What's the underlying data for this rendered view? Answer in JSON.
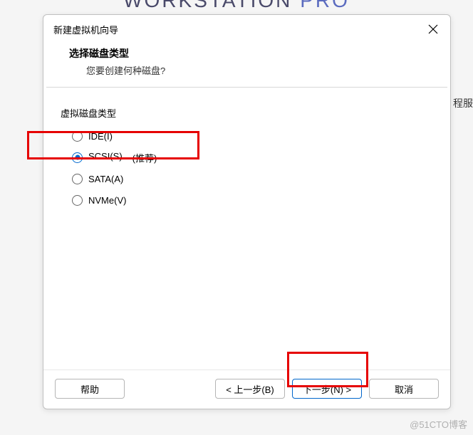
{
  "background": {
    "title_left": "WORKSTATION",
    "title_right": "PRO",
    "right_text": "程服"
  },
  "dialog": {
    "title": "新建虚拟机向导",
    "heading": "选择磁盘类型",
    "subheading": "您要创建何种磁盘?",
    "fieldset_label": "虚拟磁盘类型",
    "options": [
      {
        "label": "IDE(I)",
        "recommend": "",
        "checked": false
      },
      {
        "label": "SCSI(S)",
        "recommend": "(推荐)",
        "checked": true
      },
      {
        "label": "SATA(A)",
        "recommend": "",
        "checked": false
      },
      {
        "label": "NVMe(V)",
        "recommend": "",
        "checked": false
      }
    ],
    "buttons": {
      "help": "帮助",
      "back": "< 上一步(B)",
      "next": "下一步(N) >",
      "cancel": "取消"
    }
  },
  "watermark": "@51CTO博客"
}
